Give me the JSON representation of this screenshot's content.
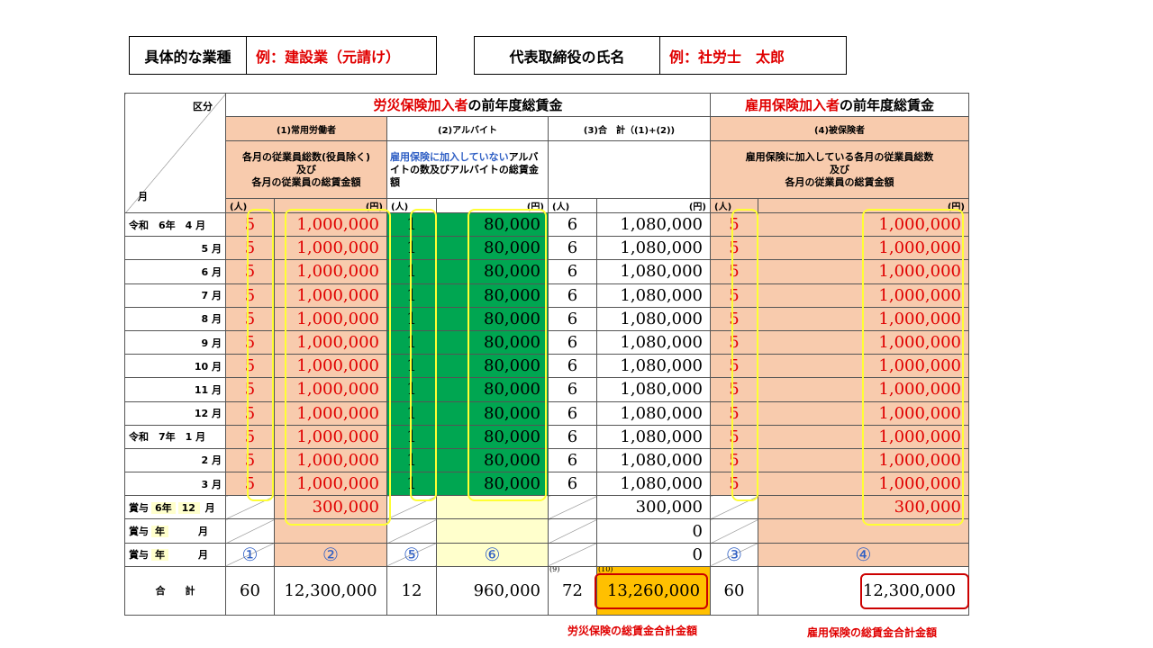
{
  "info": {
    "industry_label": "具体的な業種",
    "industry_value": "例：建設業（元請け）",
    "rep_label": "代表取締役の氏名",
    "rep_value": "例：社労士　太郎"
  },
  "header": {
    "kubun": "区分",
    "tsuki": "月",
    "rousai_red": "労災保険加入者",
    "rousai_rest": "の前年度総賃金",
    "koyou_red": "雇用保険加入者",
    "koyou_rest": "の前年度総賃金",
    "col1": "(1)常用労働者",
    "col2": "(2)アルバイト",
    "col3": "(3)合　計（(1)+(2))",
    "col4": "(4)被保険者",
    "desc1_l1": "各月の従業員総数(役員除く)",
    "desc1_l2": "及び",
    "desc1_l3": "各月の従業員の総賃金額",
    "desc2_blue": "雇用保険に加入していない",
    "desc2_rest": "アルバイトの数及びアルバイトの総賃金額",
    "desc4_l1": "雇用保険に加入している各月の従業員総数",
    "desc4_l2": "及び",
    "desc4_l3": "各月の従業員の総賃金額",
    "unit_people": "(人)",
    "unit_yen": "(円)"
  },
  "months": [
    {
      "label": "令和　6年　4 月",
      "n1": "5",
      "w1": "1,000,000",
      "n2": "1",
      "w2": "80,000",
      "n3": "6",
      "w3": "1,080,000",
      "n4": "5",
      "w4": "1,000,000"
    },
    {
      "label": "5 月",
      "n1": "5",
      "w1": "1,000,000",
      "n2": "1",
      "w2": "80,000",
      "n3": "6",
      "w3": "1,080,000",
      "n4": "5",
      "w4": "1,000,000"
    },
    {
      "label": "6 月",
      "n1": "5",
      "w1": "1,000,000",
      "n2": "1",
      "w2": "80,000",
      "n3": "6",
      "w3": "1,080,000",
      "n4": "5",
      "w4": "1,000,000"
    },
    {
      "label": "7 月",
      "n1": "5",
      "w1": "1,000,000",
      "n2": "1",
      "w2": "80,000",
      "n3": "6",
      "w3": "1,080,000",
      "n4": "5",
      "w4": "1,000,000"
    },
    {
      "label": "8 月",
      "n1": "5",
      "w1": "1,000,000",
      "n2": "1",
      "w2": "80,000",
      "n3": "6",
      "w3": "1,080,000",
      "n4": "5",
      "w4": "1,000,000"
    },
    {
      "label": "9 月",
      "n1": "5",
      "w1": "1,000,000",
      "n2": "1",
      "w2": "80,000",
      "n3": "6",
      "w3": "1,080,000",
      "n4": "5",
      "w4": "1,000,000"
    },
    {
      "label": "10 月",
      "n1": "5",
      "w1": "1,000,000",
      "n2": "1",
      "w2": "80,000",
      "n3": "6",
      "w3": "1,080,000",
      "n4": "5",
      "w4": "1,000,000"
    },
    {
      "label": "11 月",
      "n1": "5",
      "w1": "1,000,000",
      "n2": "1",
      "w2": "80,000",
      "n3": "6",
      "w3": "1,080,000",
      "n4": "5",
      "w4": "1,000,000"
    },
    {
      "label": "12 月",
      "n1": "5",
      "w1": "1,000,000",
      "n2": "1",
      "w2": "80,000",
      "n3": "6",
      "w3": "1,080,000",
      "n4": "5",
      "w4": "1,000,000"
    },
    {
      "label": "令和　7年　1 月",
      "n1": "5",
      "w1": "1,000,000",
      "n2": "1",
      "w2": "80,000",
      "n3": "6",
      "w3": "1,080,000",
      "n4": "5",
      "w4": "1,000,000"
    },
    {
      "label": "2 月",
      "n1": "5",
      "w1": "1,000,000",
      "n2": "1",
      "w2": "80,000",
      "n3": "6",
      "w3": "1,080,000",
      "n4": "5",
      "w4": "1,000,000"
    },
    {
      "label": "3 月",
      "n1": "5",
      "w1": "1,000,000",
      "n2": "1",
      "w2": "80,000",
      "n3": "6",
      "w3": "1,080,000",
      "n4": "5",
      "w4": "1,000,000"
    }
  ],
  "bonus": [
    {
      "label_pre": "賞与",
      "year": "6年",
      "month": "12",
      "label_post": "月",
      "w1": "300,000",
      "w3": "300,000",
      "w4": "300,000"
    },
    {
      "label_pre": "賞与",
      "year": "年",
      "month": "",
      "label_post": "月",
      "w1": "",
      "w3": "0",
      "w4": ""
    },
    {
      "label_pre": "賞与",
      "year": "年",
      "month": "",
      "label_post": "月",
      "w1": "",
      "w3": "0",
      "w4": ""
    }
  ],
  "markers": {
    "m1": "①",
    "m2": "②",
    "m3": "③",
    "m4": "④",
    "m5": "⑤",
    "m6": "⑥",
    "note9": "(9)",
    "note10": "(10)"
  },
  "totals": {
    "label": "合　　計",
    "n1": "60",
    "w1": "12,300,000",
    "n2": "12",
    "w2": "960,000",
    "n3": "72",
    "w3": "13,260,000",
    "n4": "60",
    "w4": "12,300,000"
  },
  "captions": {
    "rousai_total": "労災保険の総賃金合計金額",
    "koyou_total": "雇用保険の総賃金合計金額"
  },
  "colors": {
    "peach": "#f8cbad",
    "green": "#00a651",
    "yellow_highlight": "#ffff33",
    "red_text": "#e00000",
    "orange_total": "#ffc000",
    "blue_marker": "#2f5fc4"
  }
}
